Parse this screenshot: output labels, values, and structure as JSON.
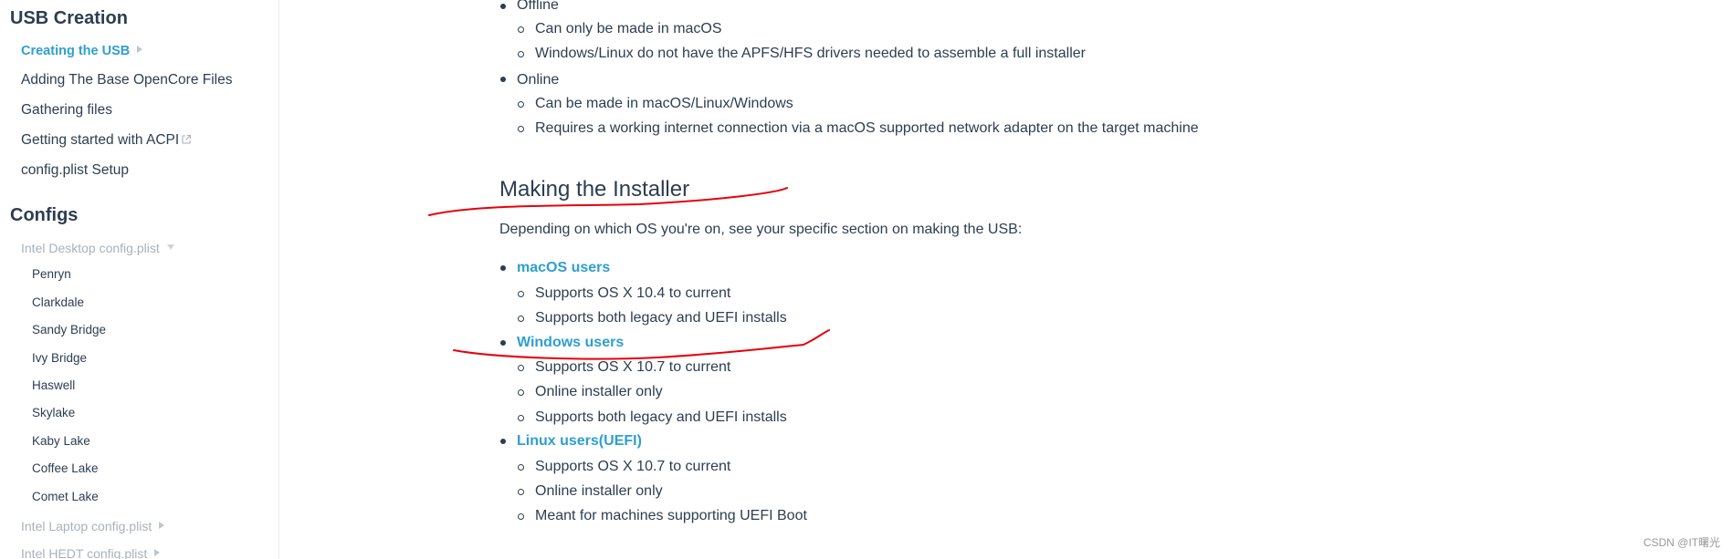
{
  "sidebar": {
    "usb_heading": "USB Creation",
    "usb_items": [
      {
        "label": "Creating the USB",
        "active": true
      },
      {
        "label": "Adding The Base OpenCore Files"
      },
      {
        "label": "Gathering files"
      },
      {
        "label": "Getting started with ACPI",
        "external": true
      },
      {
        "label": "config.plist Setup"
      }
    ],
    "configs_heading": "Configs",
    "intel_desktop": "Intel Desktop config.plist",
    "desktop_subitems": [
      "Penryn",
      "Clarkdale",
      "Sandy Bridge",
      "Ivy Bridge",
      "Haswell",
      "Skylake",
      "Kaby Lake",
      "Coffee Lake",
      "Comet Lake"
    ],
    "intel_laptop": "Intel Laptop config.plist",
    "intel_hedt": "Intel HEDT config.plist"
  },
  "content": {
    "offline_label": "Offline",
    "offline_points": [
      "Can only be made in macOS",
      "Windows/Linux do not have the APFS/HFS drivers needed to assemble a full installer"
    ],
    "online_label": "Online",
    "online_points": [
      "Can be made in macOS/Linux/Windows",
      "Requires a working internet connection via a macOS supported network adapter on the target machine"
    ],
    "section_heading": "Making the Installer",
    "intro": "Depending on which OS you're on, see your specific section on making the USB:",
    "macos_link": "macOS users",
    "macos_points": [
      "Supports OS X 10.4 to current",
      "Supports both legacy and UEFI installs"
    ],
    "windows_link": "Windows users",
    "windows_points": [
      "Supports OS X 10.7 to current",
      "Online installer only",
      "Supports both legacy and UEFI installs"
    ],
    "linux_link": "Linux users(UEFI)",
    "linux_points": [
      "Supports OS X 10.7 to current",
      "Online installer only",
      "Meant for machines supporting UEFI Boot"
    ]
  },
  "watermark": "CSDN @IT曙光",
  "colors": {
    "text": "#2c3e50",
    "link": "#2e9fd0",
    "muted": "#a8b1ba",
    "annotation": "#e8000b"
  }
}
